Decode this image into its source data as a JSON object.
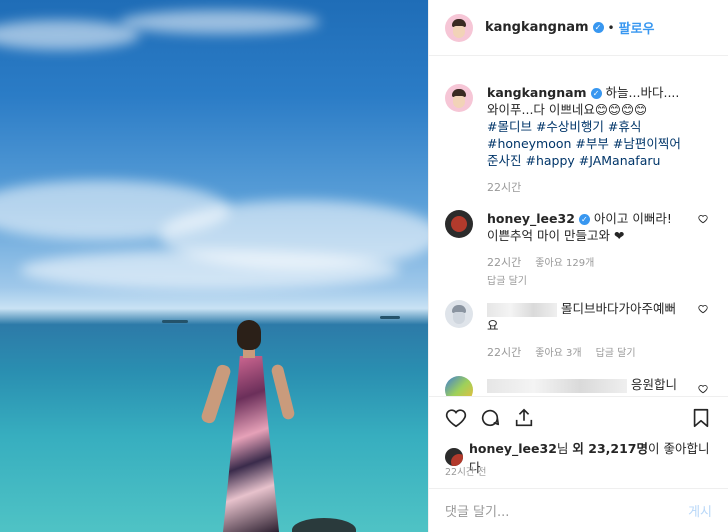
{
  "header": {
    "username": "kangkangnam",
    "separator": "•",
    "follow_label": "팔로우"
  },
  "caption": {
    "username": "kangkangnam",
    "text": "하늘...바다....와이푸...다 이쁘네요😊😊😊😊",
    "hashtags": "#몰디브 #수상비행기 #휴식 #honeymoon #부부 #남편이찍어준사진 #happy #JAManafaru",
    "time": "22시간"
  },
  "comments": [
    {
      "username": "honey_lee32",
      "text": "아이고 이뻐라! 이쁜추억 마이 만들고와 ❤",
      "time": "22시간",
      "likes": "좋아요 129개",
      "reply": "답글 달기"
    },
    {
      "username": "",
      "text": "몰디브바다가아주예뻐요",
      "time": "22시간",
      "likes": "좋아요 3개",
      "reply": "답글 달기"
    },
    {
      "username": "",
      "text": "응원합니",
      "time": "",
      "likes": "",
      "reply": ""
    }
  ],
  "likes_line": {
    "user": "honey_lee32",
    "mid": "님 ",
    "other": "외 23,217명",
    "tail": "이 좋아합니다"
  },
  "post_time": "22시간 전",
  "add_comment": {
    "placeholder": "댓글 달기...",
    "post_label": "게시"
  },
  "icons": [
    "heart-icon",
    "comment-icon",
    "share-icon",
    "bookmark-icon"
  ],
  "colors": {
    "accent": "#3897f0",
    "hashtag": "#003569",
    "muted": "#999999"
  }
}
